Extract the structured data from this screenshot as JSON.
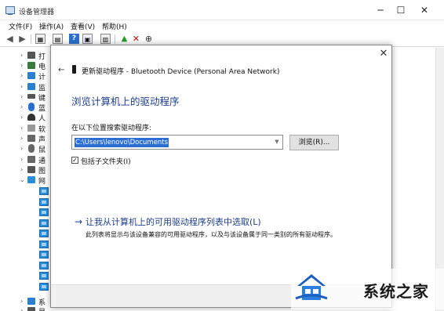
{
  "dm": {
    "title": "设备管理器",
    "window_controls": {
      "minimize": "─",
      "maximize": "☐",
      "close": "✕"
    },
    "menu": [
      "文件(F)",
      "操作(A)",
      "查看(V)",
      "帮助(H)"
    ],
    "tree_items": [
      {
        "label": "打",
        "icon": "printer-icon",
        "color": "#555555"
      },
      {
        "label": "电",
        "icon": "battery-icon",
        "color": "#3a7a3a"
      },
      {
        "label": "计",
        "icon": "computer-icon",
        "color": "#2a7fd0"
      },
      {
        "label": "监",
        "icon": "monitor-icon",
        "color": "#2a7fd0"
      },
      {
        "label": "键",
        "icon": "keyboard-icon",
        "color": "#555555"
      },
      {
        "label": "蓝",
        "icon": "bluetooth-icon",
        "color": "#2a6fd0"
      },
      {
        "label": "人",
        "icon": "person-icon",
        "color": "#333333"
      },
      {
        "label": "软",
        "icon": "software-icon",
        "color": "#777777"
      },
      {
        "label": "声",
        "icon": "speaker-icon",
        "color": "#555555"
      },
      {
        "label": "鼠",
        "icon": "mouse-icon",
        "color": "#555555"
      },
      {
        "label": "通",
        "icon": "bus-icon",
        "color": "#555555"
      },
      {
        "label": "图",
        "icon": "image-device-icon",
        "color": "#555555"
      },
      {
        "label": "网",
        "icon": "network-icon",
        "color": "#2a8fd8"
      }
    ],
    "bottom_items": [
      {
        "label": "系",
        "icon": "system-icon",
        "color": "#2a7fd0"
      },
      {
        "label": "显",
        "icon": "display-adapter-icon",
        "color": "#555555"
      }
    ]
  },
  "dialog": {
    "close": "✕",
    "back": "←",
    "header": "更新驱动程序 - Bluetooth Device (Personal Area Network)",
    "heading": "浏览计算机上的驱动程序",
    "search_label": "在以下位置搜索驱动程序:",
    "path_value": "C:\\Users\\lenovo\\Documents",
    "browse_label": "浏览(R)...",
    "include_subfolders": {
      "label": "包括子文件夹(I)",
      "checked": true,
      "mark": "✓"
    },
    "pick": {
      "arrow": "→",
      "title": "让我从计算机上的可用驱动程序列表中选取(L)",
      "description": "此列表将显示与该设备兼容的可用驱动程序，以及与该设备属于同一类别的所有驱动程序。"
    }
  },
  "watermark": {
    "text": "系统之家"
  },
  "colors": {
    "accent_blue": "#1e3f8a",
    "selection": "#2a6ed4"
  }
}
